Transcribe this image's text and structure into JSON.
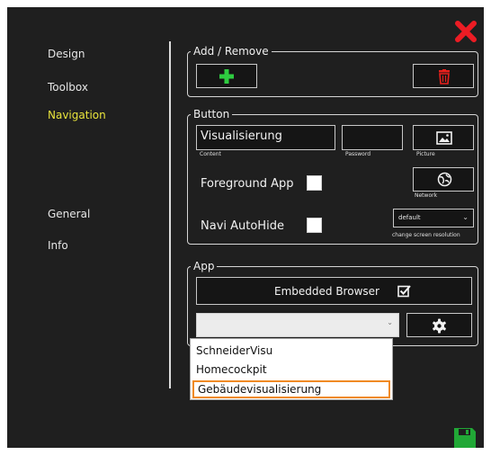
{
  "colors": {
    "window_bg": "#1f1f1f",
    "active_nav": "#e9e43c",
    "add": "#2ecc40",
    "delete": "#e8201c",
    "save": "#21a836",
    "close": "#ec1c24",
    "highlight": "#f08a24"
  },
  "sidebar": {
    "items": [
      {
        "label": "Design",
        "active": false
      },
      {
        "label": "Toolbox",
        "active": false
      },
      {
        "label": "Navigation",
        "active": true
      },
      {
        "label": "General",
        "active": false
      },
      {
        "label": "Info",
        "active": false
      }
    ]
  },
  "add_remove": {
    "legend": "Add / Remove",
    "add_icon": "plus-icon",
    "delete_icon": "trash-icon"
  },
  "button_group": {
    "legend": "Button",
    "content_value": "Visualisierung",
    "content_caption": "Content",
    "password_value": "",
    "password_caption": "Password",
    "picture_caption": "Picture",
    "picture_icon": "image-icon",
    "foreground_label": "Foreground App",
    "foreground_checked": false,
    "network_caption": "Network",
    "network_icon": "network-globe-icon",
    "navi_autohide_label": "Navi AutoHide",
    "navi_autohide_checked": false,
    "resolution_value": "default",
    "resolution_caption": "change screen resolution"
  },
  "app_group": {
    "legend": "App",
    "embedded_browser_label": "Embedded Browser",
    "embedded_browser_checked": true,
    "app_select_value": "",
    "settings_icon": "gear-icon"
  },
  "dropdown": {
    "options": [
      "SchneiderVisu",
      "Homecockpit",
      "Gebäudevisualisierung"
    ],
    "highlighted_index": 2
  },
  "window": {
    "close_icon": "close-x-icon",
    "save_icon": "save-icon"
  }
}
